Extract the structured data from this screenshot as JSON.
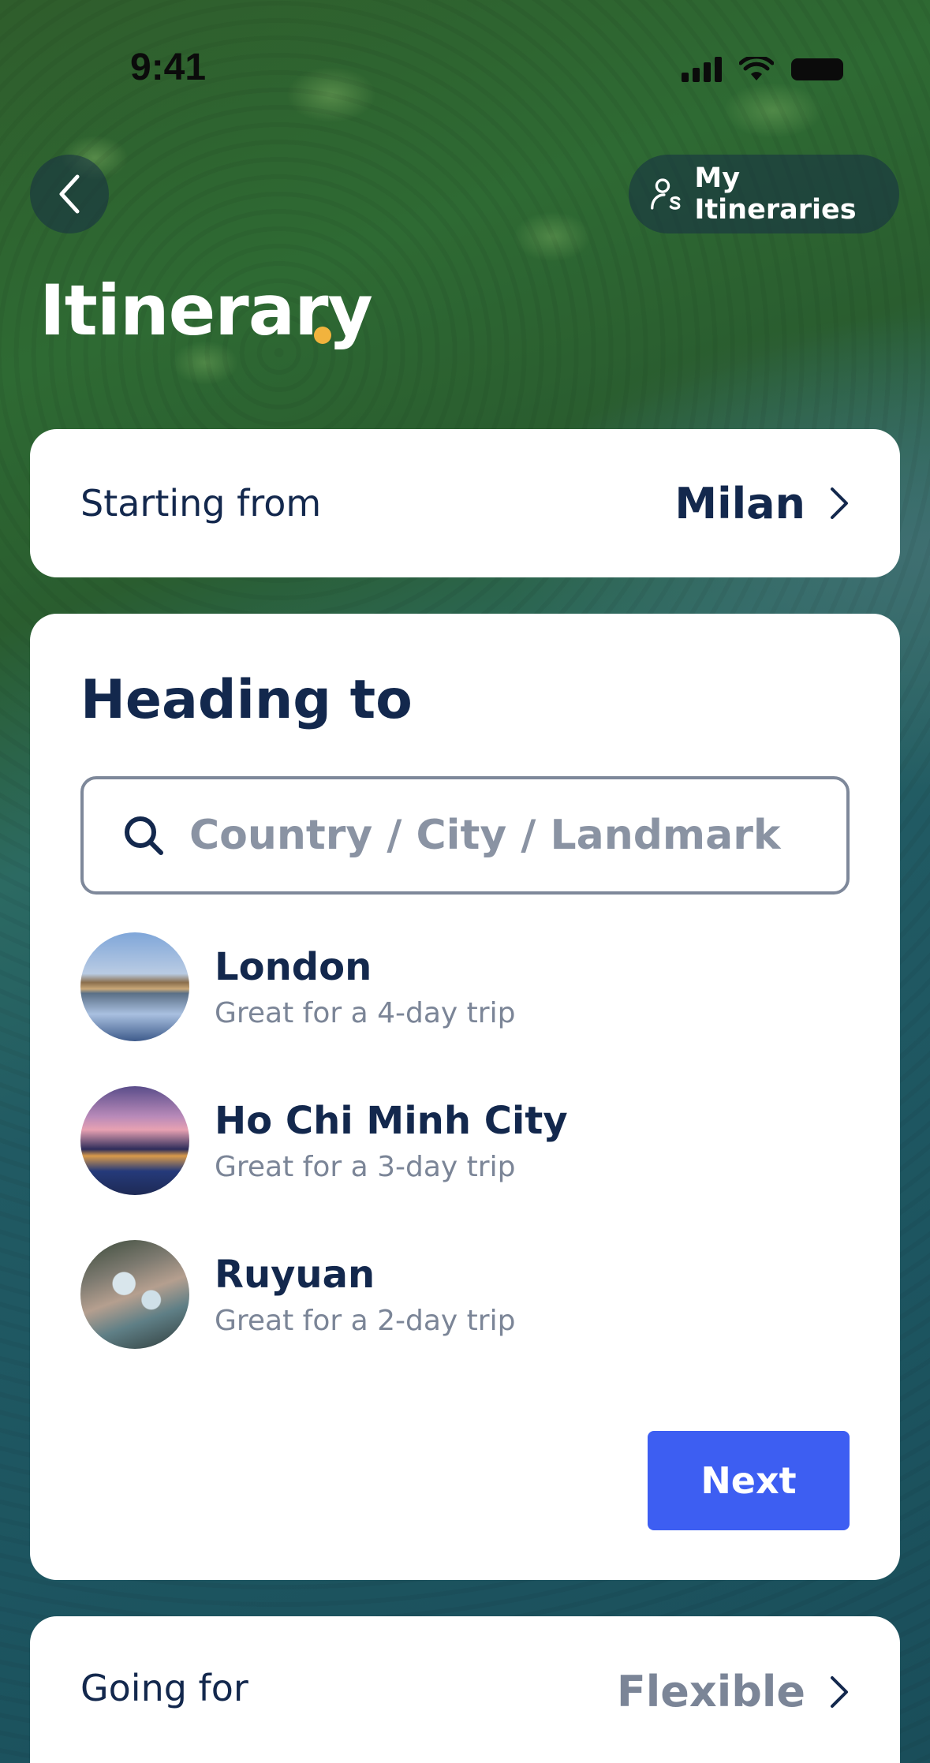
{
  "status_bar": {
    "time": "9:41"
  },
  "header": {
    "back_icon": "chevron-left-icon",
    "my_itineraries_label": "My Itineraries",
    "my_itineraries_icon": "user-list-icon",
    "title": "Itinerary",
    "title_dot_color": "#f2b33d"
  },
  "starting_from": {
    "label": "Starting from",
    "value": "Milan"
  },
  "heading_to": {
    "title": "Heading to",
    "search_placeholder": "Country / City / Landmark",
    "destinations": [
      {
        "name": "London",
        "subtitle": "Great for a 4-day trip"
      },
      {
        "name": "Ho Chi Minh City",
        "subtitle": "Great for a 3-day trip"
      },
      {
        "name": "Ruyuan",
        "subtitle": "Great for a 2-day trip"
      }
    ],
    "next_label": "Next"
  },
  "going_for": {
    "label": "Going for",
    "value": "Flexible"
  },
  "colors": {
    "accent": "#3d5ef2",
    "text_dark": "#13284d",
    "text_muted": "#7b8597"
  }
}
